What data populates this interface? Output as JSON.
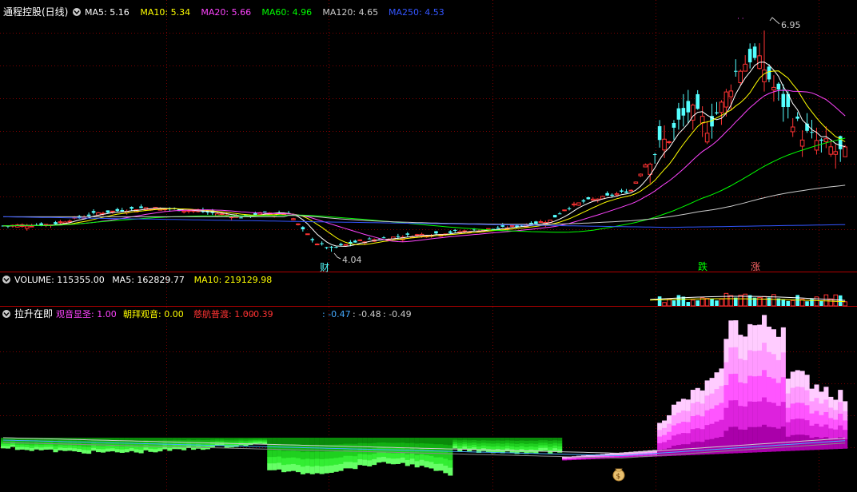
{
  "top_header": {
    "title": "通程控股(日线)",
    "ma": [
      {
        "label": "MA5: 5.16",
        "color": "#ffffff"
      },
      {
        "label": "MA10: 5.34",
        "color": "#ffff00"
      },
      {
        "label": "MA20: 5.66",
        "color": "#ff44ff"
      },
      {
        "label": "MA60: 4.96",
        "color": "#00ff00"
      },
      {
        "label": "MA120: 4.65",
        "color": "#cccccc"
      },
      {
        "label": "MA250: 4.53",
        "color": "#3355ff"
      }
    ]
  },
  "volume_header": {
    "items": [
      {
        "label": "VOLUME: 115355.00",
        "color": "#ffffff"
      },
      {
        "label": "MA5: 162829.77",
        "color": "#ffffff"
      },
      {
        "label": "MA10: 219129.98",
        "color": "#ffff00"
      }
    ]
  },
  "indicator_header": {
    "title": "拉升在即",
    "items": [
      {
        "label": "观音显圣: 1.00",
        "color": "#ff44ff"
      },
      {
        "label": "朝拜观音: 0.00",
        "color": "#ffff00"
      },
      {
        "label": "慈航普渡: 1.00",
        "color": "#ff3333"
      },
      {
        "label": ": -0.39",
        "color": "#ff3333"
      },
      {
        "label": ": -0.47",
        "color": "#44aaff"
      },
      {
        "label": ": -0.48",
        "color": "#cccccc"
      },
      {
        "label": ": -0.49",
        "color": "#cccccc"
      }
    ]
  },
  "annotations": {
    "high_price": "6.95",
    "low_price": "4.04",
    "mark_cai": "财",
    "mark_die": "跌",
    "mark_zhang": "涨"
  },
  "colors": {
    "up": "#ff3333",
    "down": "#54ffff",
    "grid": "#8b0000",
    "ma5": "#ffffff",
    "ma10": "#ffff00",
    "ma20": "#ff44ff",
    "ma60": "#00ff00",
    "ma120": "#cccccc",
    "ma250": "#3355ff"
  },
  "chart_data": {
    "type": "candlestick",
    "price_range": [
      3.8,
      7.1
    ],
    "high": 6.95,
    "low": 4.04,
    "ma_last": {
      "MA5": 5.16,
      "MA10": 5.34,
      "MA20": 5.66,
      "MA60": 4.96,
      "MA120": 4.65,
      "MA250": 4.53
    },
    "volume_last": {
      "VOLUME": 115355.0,
      "MA5": 162829.77,
      "MA10": 219129.98
    },
    "indicator_last": {
      "观音显圣": 1.0,
      "朝拜观音": 0.0,
      "慈航普渡": 1.0
    }
  }
}
